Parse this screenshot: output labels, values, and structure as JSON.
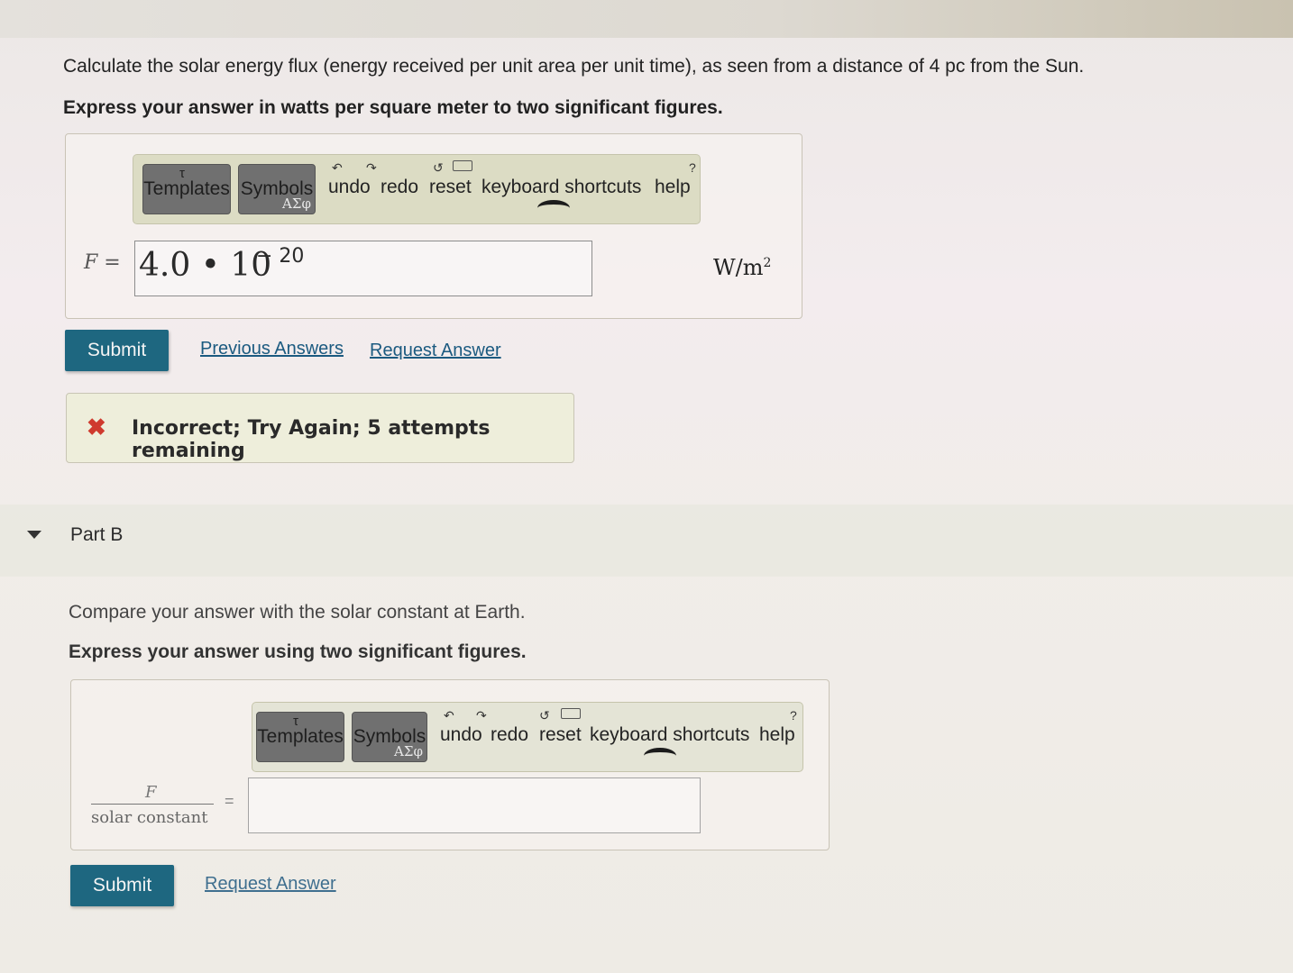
{
  "partA": {
    "question": "Calculate the solar energy flux (energy received per unit area per unit time), as seen from a distance of 4 pc from the Sun.",
    "instruction": "Express your answer in watts per square meter to two significant figures.",
    "toolbar": {
      "templates": "Templates",
      "symbols": "Symbols",
      "symbols_sub": "AΣφ",
      "undo": "undo",
      "redo": "redo",
      "reset": "reset",
      "keyboard": "keyboard shortcuts",
      "help": "help"
    },
    "variable": "F =",
    "answer_mantissa": "4.0 • 10",
    "answer_exponent": "− 20",
    "unit": "W/m",
    "unit_sup": "2",
    "submit": "Submit",
    "previous_answers": "Previous Answers",
    "request_answer": "Request Answer",
    "feedback_icon": "✖",
    "feedback": "Incorrect; Try Again; 5 attempts remaining"
  },
  "partB": {
    "title": "Part B",
    "question": "Compare your answer with the solar constant at Earth.",
    "instruction": "Express your answer using two significant figures.",
    "toolbar": {
      "templates": "Templates",
      "symbols": "Symbols",
      "symbols_sub": "AΣφ",
      "undo": "undo",
      "redo": "redo",
      "reset": "reset",
      "keyboard": "keyboard shortcuts",
      "help": "help"
    },
    "fraction_numerator": "F",
    "fraction_denominator": "solar constant",
    "equals": "=",
    "answer_value": "",
    "submit": "Submit",
    "request_answer": "Request Answer"
  },
  "colors": {
    "submit": "#1e6780",
    "link": "#1b5a80",
    "error": "#cf3a2e",
    "toolbar": "#dcdcc4"
  }
}
